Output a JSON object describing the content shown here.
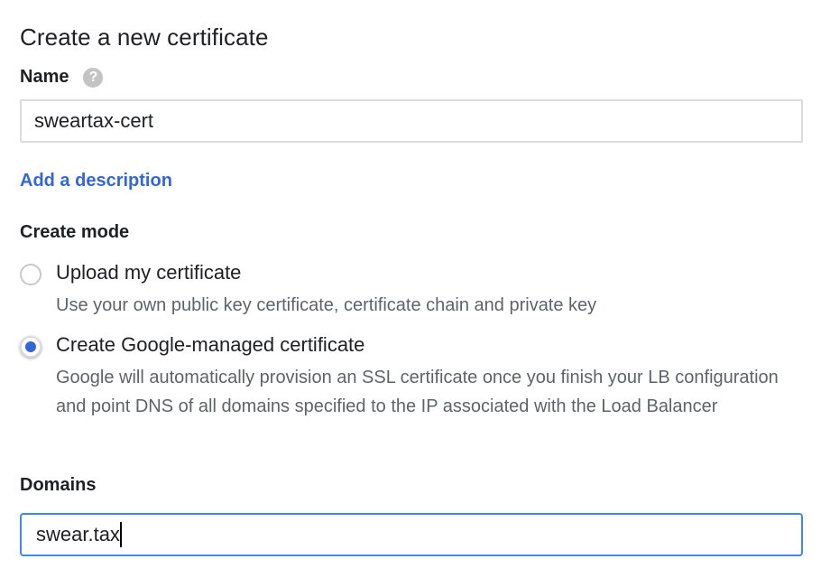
{
  "page": {
    "title": "Create a new certificate"
  },
  "name_field": {
    "label": "Name",
    "help_icon": "help-question-icon",
    "value": "sweartax-cert"
  },
  "description_link": {
    "label": "Add a description"
  },
  "create_mode": {
    "label": "Create mode",
    "selected": "google-managed",
    "options": [
      {
        "id": "upload",
        "title": "Upload my certificate",
        "description": "Use your own public key certificate, certificate chain and private key",
        "checked": false
      },
      {
        "id": "google-managed",
        "title": "Create Google-managed certificate",
        "description": "Google will automatically provision an SSL certificate once you finish your LB configuration and point DNS of all domains specified to the IP associated with the Load Balancer",
        "checked": true
      }
    ]
  },
  "domains_field": {
    "label": "Domains",
    "value": "swear.tax"
  },
  "colors": {
    "accent": "#3367d6",
    "focus_border": "#4285f4",
    "text": "#202124",
    "secondary_text": "#5f6368"
  }
}
